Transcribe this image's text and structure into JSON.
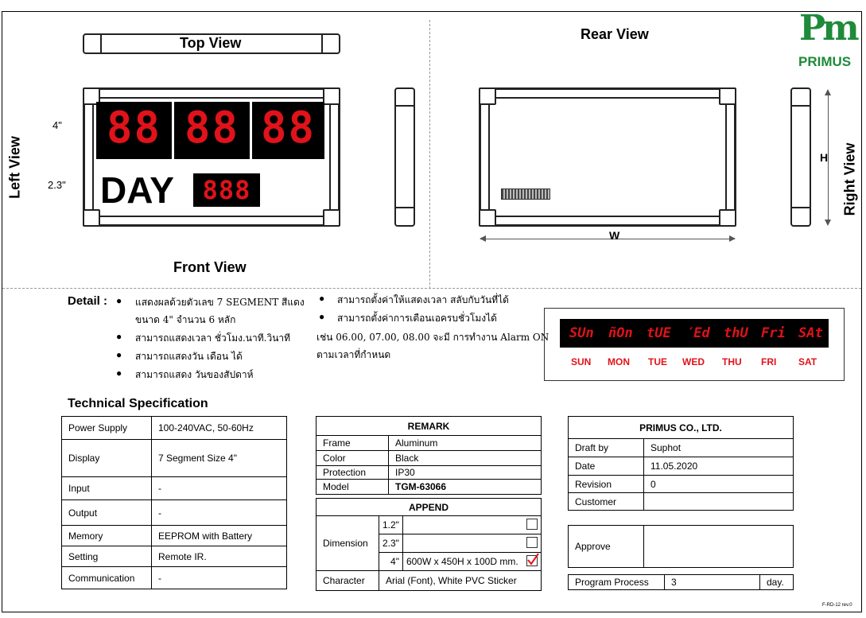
{
  "logo": {
    "letters": "Pm",
    "reg": "®",
    "name": "PRIMUS",
    "color": "#1e8a3a"
  },
  "views": {
    "top": "Top View",
    "rear": "Rear View",
    "left": "Left View",
    "right": "Right View",
    "front": "Front View",
    "dim_w": "W",
    "dim_h": "H"
  },
  "front_panel": {
    "size_big": "4\"",
    "size_small": "2.3\"",
    "big_digits": [
      "88",
      "88",
      "88"
    ],
    "day_label": "DAY",
    "small_digits": "888",
    "digit_color": "#e0121a"
  },
  "detail": {
    "label": "Detail :",
    "left_bullets": [
      "แสดงผลด้วยตัวเลข 7 SEGMENT สีแดง",
      "สามารถแสดงเวลา ชั่วโมง.นาที.วินาที",
      "สามารถแสดงวัน เดือน ได้",
      "สามารถแสดง วันของสัปดาห์"
    ],
    "left_continuation": "ขนาด 4\" จำนวน 6 หลัก",
    "right_bullets": [
      "สามารถตั้งค่าให้แสดงเวลา สลับกับวันที่ได้",
      "สามารถตั้งค่าการเตือนเอครบชั่วโมงได้"
    ],
    "right_note_1": "เช่น 06.00, 07.00, 08.00 จะมี การทำงาน Alarm ON",
    "right_note_2": "ตามเวลาที่กำหนด"
  },
  "weekdays": {
    "segments": [
      "SUn",
      "ñOn",
      "tUE",
      "′Ed",
      "thU",
      "Fri",
      "SAt"
    ],
    "labels": [
      "SUN",
      "MON",
      "TUE",
      "WED",
      "THU",
      "FRI",
      "SAT"
    ]
  },
  "tech_spec": {
    "title": "Technical Specification",
    "rows": [
      {
        "label": "Power Supply",
        "value": "100-240VAC, 50-60Hz"
      },
      {
        "label": "Display",
        "value": "7 Segment Size 4\""
      },
      {
        "label": "Input",
        "value": "-"
      },
      {
        "label": "Output",
        "value": "-"
      },
      {
        "label": "Memory",
        "value": "EEPROM with Battery"
      },
      {
        "label": "Setting",
        "value": "Remote IR."
      },
      {
        "label": "Communication",
        "value": "-"
      }
    ]
  },
  "remark": {
    "title": "REMARK",
    "rows": [
      {
        "label": "Frame",
        "value": "Aluminum"
      },
      {
        "label": "Color",
        "value": "Black"
      },
      {
        "label": "Protection",
        "value": "IP30"
      },
      {
        "label": "Model",
        "value": "TGM-63066"
      }
    ]
  },
  "append": {
    "title": "APPEND",
    "dimension_label": "Dimension",
    "sizes": [
      {
        "size": "1.2\"",
        "value": "",
        "checked": false
      },
      {
        "size": "2.3\"",
        "value": "",
        "checked": false
      },
      {
        "size": "4\"",
        "value": "600W x 450H x 100D mm.",
        "checked": true
      }
    ],
    "character_label": "Character",
    "character_value": "Arial (Font), White PVC Sticker"
  },
  "company": {
    "title": "PRIMUS CO., LTD.",
    "rows": [
      {
        "label": "Draft by",
        "value": "Suphot"
      },
      {
        "label": "Date",
        "value": "11.05.2020"
      },
      {
        "label": "Revision",
        "value": "0"
      },
      {
        "label": "Customer",
        "value": ""
      }
    ],
    "approve_label": "Approve",
    "program_label": "Program Process",
    "program_value": "3",
    "program_unit": "day."
  },
  "footer_code": "F-RD-12 rev.0"
}
